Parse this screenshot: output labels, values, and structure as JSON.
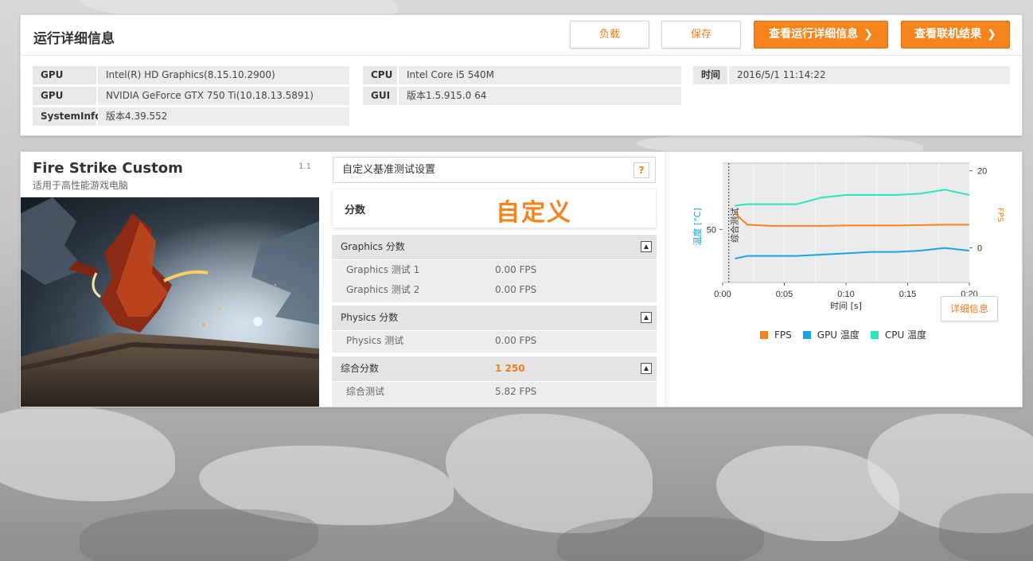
{
  "colors": {
    "accent": "#f5841f",
    "fps": "#f5841f",
    "gpu_temp": "#1aa3e8",
    "cpu_temp": "#2be6b8"
  },
  "header": {
    "title": "运行详细信息",
    "btn_load": "负载",
    "btn_save": "保存",
    "btn_view_details": "查看运行详细信息",
    "btn_view_online": "查看联机结果",
    "chevron_icon": "chevron-right-icon"
  },
  "sysinfo": {
    "col1": [
      {
        "key": "GPU",
        "value": "Intel(R) HD Graphics(8.15.10.2900)"
      },
      {
        "key": "GPU",
        "value": "NVIDIA GeForce GTX 750 Ti(10.18.13.5891)"
      },
      {
        "key": "SystemInfo",
        "value": "版本4.39.552"
      }
    ],
    "col2": [
      {
        "key": "CPU",
        "value": "Intel Core i5 540M"
      },
      {
        "key": "GUI",
        "value": "版本1.5.915.0 64"
      }
    ],
    "col3": [
      {
        "key": "时间",
        "value": "2016/5/1 11:14:22"
      }
    ]
  },
  "test": {
    "name": "Fire Strike Custom",
    "subtitle": "适用于高性能游戏电脑",
    "version": "1.1"
  },
  "settings": {
    "label": "自定义基准测试设置",
    "help": "?"
  },
  "score": {
    "label": "分数",
    "value": "自定义"
  },
  "sections": [
    {
      "label": "Graphics 分数",
      "value": "",
      "rows": [
        {
          "name": "Graphics 测试 1",
          "value": "0.00 FPS"
        },
        {
          "name": "Graphics 测试 2",
          "value": "0.00 FPS"
        }
      ]
    },
    {
      "label": "Physics 分数",
      "value": "",
      "rows": [
        {
          "name": "Physics 测试",
          "value": "0.00 FPS"
        }
      ]
    },
    {
      "label": "综合分数",
      "value": "1 250",
      "rows": [
        {
          "name": "综合测试",
          "value": "5.82 FPS"
        }
      ]
    }
  ],
  "chart_data": {
    "type": "line",
    "xlabel": "时间 [s]",
    "ylabel_left": "温度 [°C]",
    "ylabel_right": "FPS",
    "x_ticks": [
      "0:00",
      "0:05",
      "0:10",
      "0:15",
      "0:20"
    ],
    "y_left_ticks": [
      "50"
    ],
    "y_right_ticks": [
      "20",
      "0"
    ],
    "marker_label": "综合测试",
    "marker_x": 0.5,
    "x_range": [
      0,
      20
    ],
    "y_left_range": [
      30,
      75
    ],
    "y_right_range": [
      -9,
      22
    ],
    "series": [
      {
        "name": "FPS",
        "axis": "right",
        "x": [
          1,
          2,
          4,
          6,
          8,
          10,
          12,
          14,
          16,
          18,
          20
        ],
        "values": [
          9,
          6,
          5.7,
          5.7,
          5.7,
          5.8,
          5.8,
          5.8,
          5.9,
          6,
          6
        ]
      },
      {
        "name": "GPU 温度",
        "axis": "left",
        "x": [
          1,
          2,
          4,
          6,
          8,
          10,
          12,
          14,
          16,
          18,
          20
        ],
        "values": [
          39,
          40,
          40,
          40,
          40.5,
          41,
          41.5,
          41.5,
          42,
          43,
          42
        ]
      },
      {
        "name": "CPU 温度",
        "axis": "left",
        "x": [
          1,
          2,
          4,
          6,
          8,
          10,
          12,
          14,
          16,
          18,
          20
        ],
        "values": [
          59,
          59.5,
          59.5,
          59.5,
          62,
          63,
          63,
          63,
          63.5,
          65,
          63
        ]
      }
    ]
  },
  "chart": {
    "detail_button": "详细信息",
    "legend": [
      {
        "name": "FPS",
        "color": "#f5841f"
      },
      {
        "name": "GPU 温度",
        "color": "#1aa3e8"
      },
      {
        "name": "CPU 温度",
        "color": "#2be6b8"
      }
    ]
  }
}
